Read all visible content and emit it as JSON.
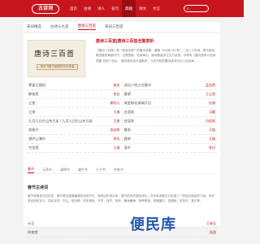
{
  "logo_text": "古诗词",
  "nav": [
    "首页",
    "古诗",
    "诗人",
    "名句",
    "典籍",
    "诗文",
    "文言"
  ],
  "top_tabs": [
    "宋词精选",
    "古诗十九首",
    "唐诗三百首",
    "宋词三百首"
  ],
  "book": {
    "cover_title": "唐诗三百首",
    "cover_subtitle": "—带本书看古都城的历史故事—",
    "title": "唐诗三百首|唐诗三百首全集赏析",
    "description": "《唐诗三百首》是一部流传很广的唐诗选集。唐朝（618年-907年）二百八十年间，是中国诗歌发展的黄金时代，云蒸霞蔚，名家辈出，唐诗数量多达五万余首。孙琴安《唐诗选本六百种提要·自序》指出：“唐诗选本经大量散佚，今天所知的唐诗选本仍达六百余种……"
  },
  "poems": [
    {
      "left": {
        "name": "寒窗日琶相",
        "author": "朱庆"
      },
      "right": {
        "name": "送杜少府之任蜀州",
        "author": "孟浩然"
      }
    },
    {
      "left": {
        "name": "静夜思",
        "author": "李白"
      },
      "right": {
        "name": "春望",
        "author": "王之涣"
      }
    },
    {
      "left": {
        "name": "江雪",
        "author": "柳宗元"
      },
      "right": {
        "name": "城里梅花满城开见",
        "author": "杜甫"
      }
    },
    {
      "left": {
        "name": "江南",
        "author": "王维"
      },
      "right": {
        "name": "白居易",
        "author": "元稹"
      }
    },
    {
      "left": {
        "name": "九月九日忆山东兄弟 / 九月九日忆山东兄弟",
        "author": "王维"
      },
      "right": {
        "name": "白居易",
        "author": "白居易"
      }
    },
    {
      "left": {
        "name": "渔歌子",
        "author": "张志和"
      },
      "right": {
        "name": "暮雨",
        "author": "王维"
      }
    },
    {
      "left": {
        "name": "望庐山瀑布",
        "author": "李白"
      },
      "right": {
        "name": "鹿柴",
        "author": "王维"
      }
    },
    {
      "left": {
        "name": "竹里馆",
        "author": "王维"
      },
      "right": {
        "name": "清平",
        "author": "李白"
      }
    }
  ],
  "filters": [
    "春节",
    "元宵节",
    "清明节",
    "端午节",
    "七夕节",
    "中秋节"
  ],
  "section": {
    "title": "春节古诗词",
    "body": "春节有着悠久的历史，春节是中国最隆重的传统节日，俗称过年或大年。春节的历史源远流长，在传承发展中已形成了一些较为固定的习俗，有许多还相传至今，如买年货、扫尘、贴对联、吃年夜饭、守岁、拜岁、拜年、舞龙舞狮、拜神祭祖、祈福攘灾、游锣鼓、游花市、赏灯等。"
  },
  "list": [
    {
      "name": "元日",
      "author": "王安石"
    },
    {
      "name": "除夜雪",
      "author": "陆游"
    }
  ],
  "watermark": "便民库"
}
